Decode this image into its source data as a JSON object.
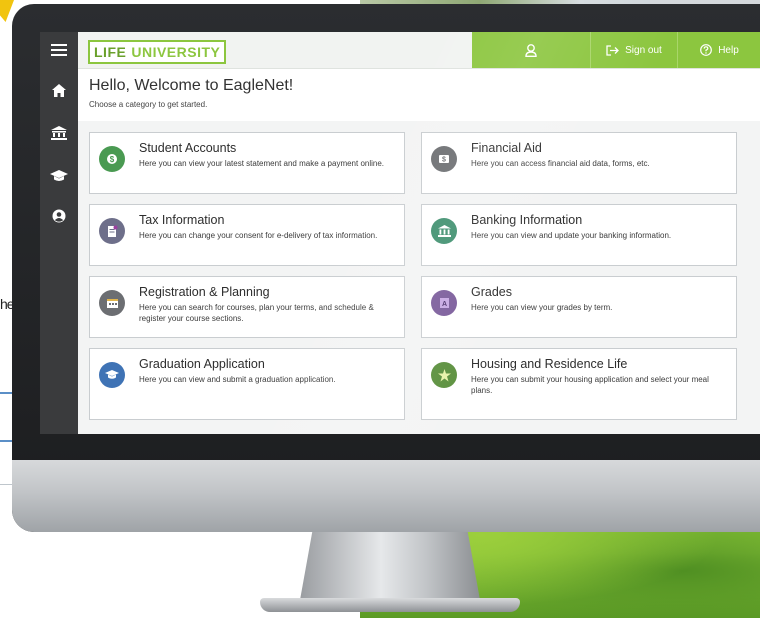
{
  "background": {
    "partial_text": "he"
  },
  "app": {
    "logo": {
      "life": "LIFE",
      "university": "UNIVERSITY"
    },
    "header": {
      "user_icon": "user-icon",
      "sign_out_label": "Sign out",
      "help_label": "Help"
    },
    "sidebar": {
      "items": [
        {
          "name": "menu",
          "icon": "hamburger-icon"
        },
        {
          "name": "home",
          "icon": "home-icon"
        },
        {
          "name": "finance",
          "icon": "bank-icon"
        },
        {
          "name": "academics",
          "icon": "graduation-cap-icon"
        },
        {
          "name": "profile",
          "icon": "user-circle-icon"
        }
      ]
    },
    "welcome": {
      "title": "Hello, Welcome to EagleNet!",
      "subtitle": "Choose a category to get started."
    },
    "cards": [
      {
        "title": "Student Accounts",
        "description": "Here you can view your latest statement and make a payment online.",
        "icon": "money-icon",
        "icon_color": "#4a9a52"
      },
      {
        "title": "Financial Aid",
        "description": "Here you can access financial aid data, forms, etc.",
        "icon": "dollar-icon",
        "icon_color": "#6d6f72"
      },
      {
        "title": "Tax Information",
        "description": "Here you can change your consent for e-delivery of tax information.",
        "icon": "tax-document-icon",
        "icon_color": "#6e6f8a"
      },
      {
        "title": "Banking Information",
        "description": "Here you can view and update your banking information.",
        "icon": "bank-icon",
        "icon_color": "#3e8f6e"
      },
      {
        "title": "Registration & Planning",
        "description": "Here you can search for courses, plan your terms, and schedule & register your course sections.",
        "icon": "registration-icon",
        "icon_color": "#6c6e72"
      },
      {
        "title": "Grades",
        "description": "Here you can view your grades by term.",
        "icon": "grades-icon",
        "icon_color": "#7a5b9a"
      },
      {
        "title": "Graduation Application",
        "description": "Here you can view and submit a graduation application.",
        "icon": "graduation-icon",
        "icon_color": "#3f73b5"
      },
      {
        "title": "Housing and Residence Life",
        "description": "Here you can submit your housing application and select your meal plans.",
        "icon": "housing-icon",
        "icon_color": "#5a8f3c"
      }
    ],
    "colors": {
      "accent_green": "#8cc63f",
      "sidebar_bg": "#3a3b3d",
      "card_border": "#c9cdd0"
    }
  }
}
